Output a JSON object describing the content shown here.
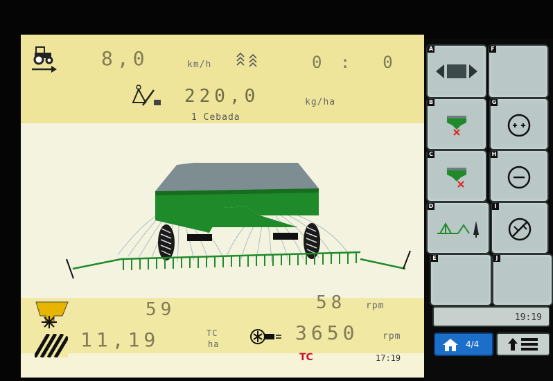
{
  "header": {
    "speed": "8,0",
    "speed_unit": "km/h",
    "counter": "0 :  0",
    "rate": "220,0",
    "rate_unit": "kg/ha",
    "product": "1 Cebada"
  },
  "metrics": {
    "hopper_value": "59",
    "shaft_rpm": "58",
    "shaft_rpm_unit": "rpm",
    "area_value": "11,19",
    "area_unit_top": "TC",
    "area_unit_bottom": "ha",
    "fan_rpm": "3650",
    "fan_rpm_unit": "rpm"
  },
  "status": {
    "logo": "TC",
    "time": "17:19"
  },
  "softkeys": [
    {
      "letter": "A",
      "icon": "section-width-icon"
    },
    {
      "letter": "F",
      "icon": ""
    },
    {
      "letter": "B",
      "icon": "hopper-left-off-icon"
    },
    {
      "letter": "G",
      "icon": "rate-increase-icon"
    },
    {
      "letter": "C",
      "icon": "hopper-right-off-icon"
    },
    {
      "letter": "H",
      "icon": "rate-decrease-icon"
    },
    {
      "letter": "D",
      "icon": "boom-trees-icon"
    },
    {
      "letter": "I",
      "icon": "rate-reset-icon"
    },
    {
      "letter": "E",
      "icon": ""
    },
    {
      "letter": "J",
      "icon": ""
    }
  ],
  "side": {
    "clock": "19:19",
    "page": "4/4"
  },
  "colors": {
    "machine_green": "#1f8a2a",
    "lcd_text": "#807b55",
    "softkey_bg": "#b9c7c7",
    "home_button": "#1c6fc9"
  }
}
